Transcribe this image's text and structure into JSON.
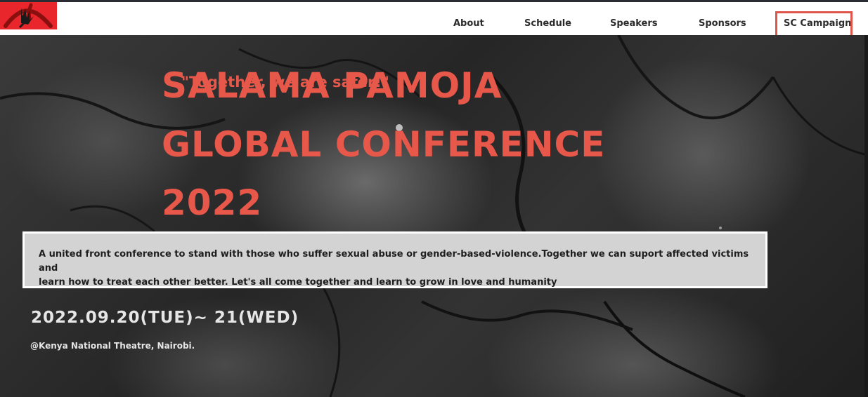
{
  "header": {
    "logo_icon": "red-hand-logo-icon",
    "nav": [
      {
        "label": "About"
      },
      {
        "label": "Schedule"
      },
      {
        "label": "Speakers"
      },
      {
        "label": "Sponsors"
      },
      {
        "label": "SC Campaign"
      }
    ]
  },
  "hero": {
    "tagline": "\"Together, we are safer!\"",
    "title_lines": [
      "SALAMA PAMOJA",
      "GLOBAL CONFERENCE",
      "2022"
    ],
    "description_line1": "A united front conference to stand with those who suffer sexual abuse or gender-based-violence.Together we can suport affected victims and",
    "description_line2": "learn how to treat each other better. Let's all come together and learn to grow in love and humanity",
    "date": "2022.09.20(TUE)~ 21(WED)",
    "venue": "@Kenya National Theatre, Nairobi."
  },
  "colors": {
    "accent": "#e8584a",
    "logo_bg": "#e8262b",
    "highlight_border": "#e0554a"
  }
}
